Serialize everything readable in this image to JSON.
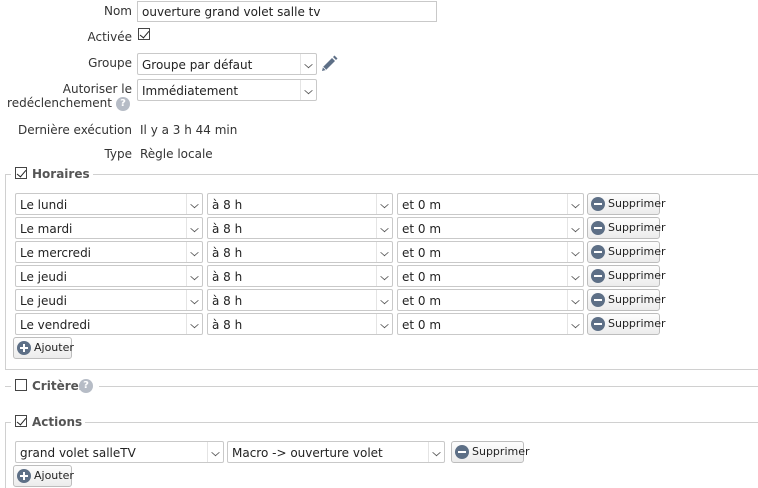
{
  "form": {
    "nom_label": "Nom",
    "nom_value": "ouverture grand volet salle tv",
    "activee_label": "Activée",
    "groupe_label": "Groupe",
    "groupe_value": "Groupe par défaut",
    "autoriser_label_1": "Autoriser le",
    "autoriser_label_2": "redéclenchement",
    "autoriser_value": "Immédiatement",
    "derniere_label": "Dernière exécution",
    "derniere_value": "Il y a 3 h 44 min",
    "type_label": "Type",
    "type_value": "Règle locale"
  },
  "horaires": {
    "title": "Horaires",
    "rows": [
      {
        "day": "Le lundi",
        "hour": "à 8 h",
        "minute": "et 0 m"
      },
      {
        "day": "Le mardi",
        "hour": "à 8 h",
        "minute": "et 0 m"
      },
      {
        "day": "Le mercredi",
        "hour": "à 8 h",
        "minute": "et 0 m"
      },
      {
        "day": "Le jeudi",
        "hour": "à 8 h",
        "minute": "et 0 m"
      },
      {
        "day": "Le jeudi",
        "hour": "à 8 h",
        "minute": "et 0 m"
      },
      {
        "day": "Le vendredi",
        "hour": "à 8 h",
        "minute": "et 0 m"
      }
    ],
    "delete_label": "Supprimer",
    "add_label": "Ajouter"
  },
  "criteres": {
    "title": "Critères"
  },
  "actions": {
    "title": "Actions",
    "device_value": "grand volet salleTV",
    "action_value": "Macro -> ouverture volet",
    "delete_label": "Supprimer",
    "add_label": "Ajouter"
  },
  "icons": {
    "help": "?",
    "pencil_color": "#5d6f86",
    "button_icon_color": "#5d6f86"
  }
}
